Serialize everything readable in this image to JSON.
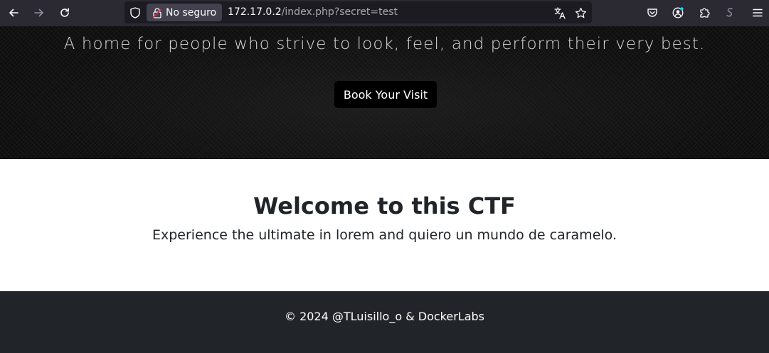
{
  "browser": {
    "security_label": "No seguro",
    "url_host": "172.17.0.2",
    "url_path": "/index.php?secret=test",
    "icons": {
      "back": "back-arrow-icon",
      "forward": "forward-arrow-icon",
      "reload": "reload-icon",
      "shield": "tracking-shield-icon",
      "lock": "insecure-lock-icon",
      "translate": "translate-icon",
      "bookmark": "bookmark-star-icon",
      "pocket": "pocket-icon",
      "account": "account-icon",
      "extensions": "extensions-icon",
      "extra": "extension-s-icon",
      "menu": "hamburger-menu-icon"
    },
    "colors": {
      "toolbar": "#2b2a33",
      "urlbar": "#1c1b22",
      "chip": "#42414d"
    }
  },
  "hero": {
    "tagline": "A home for people who strive to look, feel, and perform their very best.",
    "book_button_label": "Book Your Visit"
  },
  "welcome": {
    "title": "Welcome to this CTF",
    "text": "Experience the ultimate in lorem and quiero un mundo de caramelo."
  },
  "footer": {
    "text": "© 2024 @TLuisillo_o & DockerLabs"
  }
}
